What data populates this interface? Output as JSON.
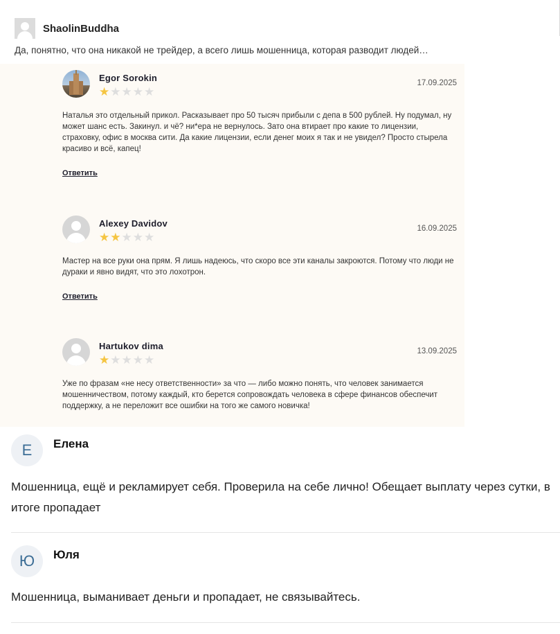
{
  "top_comment": {
    "author": "ShaolinBuddha",
    "text": "Да, понятно, что она никакой не трейдер, а всего лишь мошенница, которая разводит людей…"
  },
  "reviews": [
    {
      "name": "Egor Sorokin",
      "date": "17.09.2025",
      "rating": 1,
      "max_rating": 5,
      "text": "Наталья это отдельный прикол. Расказывает про 50 тысяч прибыли с депа в 500 рублей. Ну подумал, ну может шанс есть. Закинул. и чё? ни*ера не вернулось. Зато она втирает про какие то лицензии, страховку, офис в москва сити. Да какие лицензии, если денег моих я так и не увидел? Просто стырела красиво и всё, капец!",
      "reply_label": "Ответить"
    },
    {
      "name": "Alexey Davidov",
      "date": "16.09.2025",
      "rating": 2,
      "max_rating": 5,
      "text": "Мастер на все руки она прям. Я лишь надеюсь, что скоро все эти каналы закроются. Потому что люди не дураки и явно видят, что это лохотрон.",
      "reply_label": "Ответить"
    },
    {
      "name": "Hartukov dima",
      "date": "13.09.2025",
      "rating": 1,
      "max_rating": 5,
      "text": "Уже по фразам «не несу ответственности» за что — либо можно понять, что человек занимается мошенничеством, потому каждый, кто берется сопровождать человека в сфере финансов обеспечит поддержку, а не переложит все ошибки на того же самого новичка!"
    }
  ],
  "comments": [
    {
      "initial": "Е",
      "name": "Елена",
      "text": "Мошенница, ещё и рекламирует себя. Проверила на себе лично! Обещает выплату через сутки, в итоге пропадает"
    },
    {
      "initial": "Ю",
      "name": "Юля",
      "text": "Мошенница, выманивает деньги и пропадает, не связывайтесь."
    }
  ],
  "colors": {
    "star_on": "#f5c542",
    "star_off": "#dedede",
    "reviews_bg": "#fdfaf5",
    "initial_color": "#3d6e96"
  }
}
